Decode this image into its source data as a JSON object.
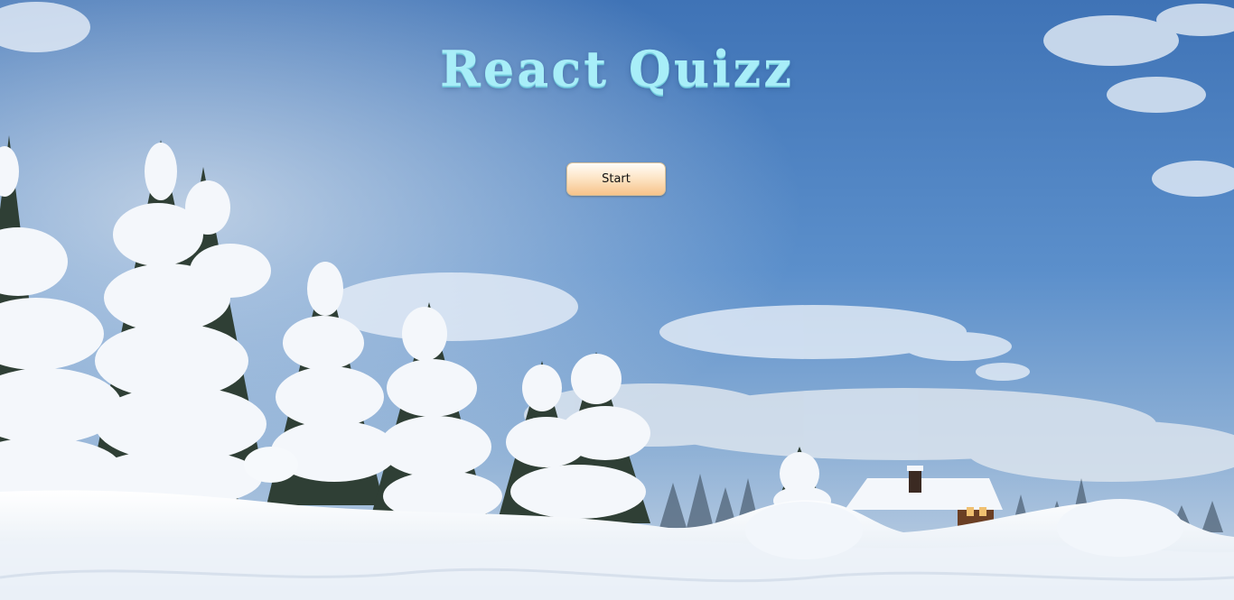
{
  "app": {
    "title": "React Quizz"
  },
  "controls": {
    "start_label": "Start"
  },
  "background": {
    "scene": "snowy-winter-landscape",
    "sky_color": "#4a7fbd",
    "snow_color": "#f4f8fc"
  }
}
